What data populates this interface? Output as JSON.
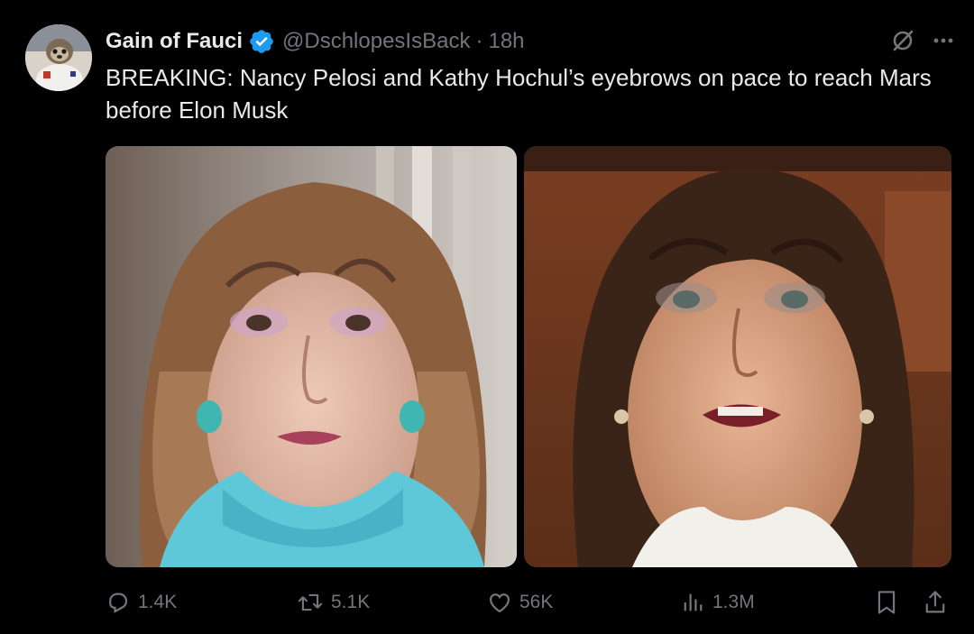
{
  "author": {
    "display_name": "Gain of Fauci",
    "handle": "@DschlopesIsBack",
    "separator": "·",
    "time": "18h",
    "verified_color": "#1d9bf0"
  },
  "post": {
    "text": "BREAKING: Nancy Pelosi and Kathy Hochul’s eyebrows on pace to reach Mars before Elon Musk"
  },
  "media": {
    "images": [
      {
        "subject": "woman-with-arched-eyebrows-turquoise-top"
      },
      {
        "subject": "woman-with-arched-eyebrows-white-collar"
      }
    ]
  },
  "actions": {
    "replies": "1.4K",
    "reposts": "5.1K",
    "likes": "56K",
    "views": "1.3M"
  },
  "icons": {
    "reply": "reply-icon",
    "repost": "repost-icon",
    "like": "like-icon",
    "views": "views-icon",
    "bookmark": "bookmark-icon",
    "share": "share-icon",
    "grok": "grok-icon",
    "more": "more-icon"
  },
  "theme": {
    "background": "#000000",
    "text": "#e7e9ea",
    "muted": "#71767b"
  }
}
